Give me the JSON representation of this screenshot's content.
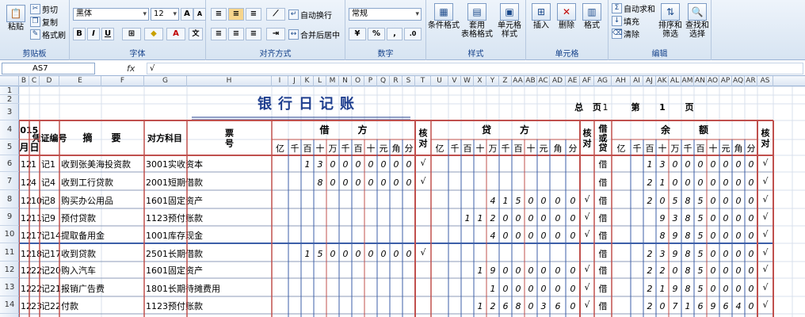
{
  "ribbon": {
    "clipboard": {
      "paste": "粘贴",
      "cut": "剪切",
      "copy": "复制",
      "format_painter": "格式刷",
      "label": "剪贴板"
    },
    "font": {
      "name": "黑体",
      "size": "12",
      "bold": "B",
      "italic": "I",
      "underline": "U",
      "label": "字体",
      "grow": "A",
      "shrink": "A"
    },
    "alignment": {
      "wrap": "自动换行",
      "merge": "合并后居中",
      "label": "对齐方式"
    },
    "number": {
      "format": "常规",
      "percent": "%",
      "comma": ",",
      "label": "数字"
    },
    "styles": {
      "conditional": "条件格式",
      "table": "套用\n表格格式",
      "cell": "单元格\n样式",
      "label": "样式"
    },
    "cells": {
      "insert": "插入",
      "delete": "删除",
      "format": "格式",
      "label": "单元格"
    },
    "editing": {
      "autosum": "自动求和",
      "fill": "填充",
      "clear": "清除",
      "sort": "排序和\n筛选",
      "find": "查找和\n选择",
      "label": "编辑"
    }
  },
  "formula_bar": {
    "name_box": "AS7",
    "fx": "fx",
    "content": "√"
  },
  "columns": [
    "B",
    "C",
    "D",
    "E",
    "F",
    "G",
    "H",
    "I",
    "J",
    "K",
    "L",
    "M",
    "N",
    "O",
    "P",
    "Q",
    "R",
    "S",
    "T",
    "U",
    "V",
    "W",
    "X",
    "Y",
    "Z",
    "AA",
    "AB",
    "AC",
    "AD",
    "AE",
    "AF",
    "AG",
    "AH",
    "AI",
    "AJ",
    "AK",
    "AL",
    "AM",
    "AN",
    "AO",
    "AP",
    "AQ",
    "AR",
    "AS"
  ],
  "rows": [
    "1",
    "2",
    "3",
    "4",
    "5",
    "6",
    "7",
    "8",
    "9",
    "10",
    "11",
    "12",
    "13",
    "14"
  ],
  "ledger": {
    "title": "银行日记账",
    "total_pages_label": "总 页",
    "total_pages": "1",
    "page_prefix": "第",
    "page_no": "1",
    "page_suffix": "页",
    "headers": {
      "year": "2015",
      "month": "月",
      "day": "日",
      "voucher": "凭证编号",
      "summary": "摘　　要",
      "account": "对方科目",
      "ticket": "票\n号",
      "debit": "借　　　方",
      "check": "核\n对",
      "credit": "贷　　　方",
      "direction": "借\n或\n贷",
      "balance": "余　　　额"
    },
    "digits": [
      "亿",
      "千",
      "百",
      "十",
      "万",
      "千",
      "百",
      "十",
      "元",
      "角",
      "分"
    ],
    "entries": [
      {
        "month": "12",
        "day": "1",
        "voucher": "记1",
        "summary": "收到张美海投资款",
        "account": "3001实收资本",
        "debit": "130000000",
        "dcheck": "√",
        "credit": "",
        "ccheck": "",
        "dir": "借",
        "balance": "130000000",
        "bcheck": "√"
      },
      {
        "month": "12",
        "day": "4",
        "voucher": "记4",
        "summary": "收到工行贷款",
        "account": "2001短期借款",
        "debit": "80000000",
        "dcheck": "√",
        "credit": "",
        "ccheck": "",
        "dir": "借",
        "balance": "210000000",
        "bcheck": "√"
      },
      {
        "month": "12",
        "day": "10",
        "voucher": "记8",
        "summary": "购买办公用品",
        "account": "1601固定资产",
        "debit": "",
        "dcheck": "",
        "credit": "4150000",
        "ccheck": "√",
        "dir": "借",
        "balance": "205850000",
        "bcheck": "√"
      },
      {
        "month": "12",
        "day": "11",
        "voucher": "记9",
        "summary": "预付贷款",
        "account": "1123预付账款",
        "debit": "",
        "dcheck": "",
        "credit": "112000000",
        "ccheck": "√",
        "dir": "借",
        "balance": "93850000",
        "bcheck": "√"
      },
      {
        "month": "12",
        "day": "17",
        "voucher": "记14",
        "summary": "提取备用金",
        "account": "1001库存现金",
        "debit": "",
        "dcheck": "",
        "credit": "4000000",
        "ccheck": "√",
        "dir": "借",
        "balance": "89850000",
        "bcheck": "√"
      },
      {
        "month": "12",
        "day": "18",
        "voucher": "记17",
        "summary": "收到贷款",
        "account": "2501长期借款",
        "debit": "150000000",
        "dcheck": "√",
        "credit": "",
        "ccheck": "",
        "dir": "借",
        "balance": "239850000",
        "bcheck": "√"
      },
      {
        "month": "12",
        "day": "22",
        "voucher": "记20",
        "summary": "购入汽车",
        "account": "1601固定资产",
        "debit": "",
        "dcheck": "",
        "credit": "19000000",
        "ccheck": "√",
        "dir": "借",
        "balance": "220850000",
        "bcheck": "√"
      },
      {
        "month": "12",
        "day": "22",
        "voucher": "记21",
        "summary": "报销广告费",
        "account": "1801长期待摊费用",
        "debit": "",
        "dcheck": "",
        "credit": "1000000",
        "ccheck": "√",
        "dir": "借",
        "balance": "219850000",
        "bcheck": "√"
      },
      {
        "month": "12",
        "day": "23",
        "voucher": "记22",
        "summary": "付款",
        "account": "1123预付账款",
        "debit": "",
        "dcheck": "",
        "credit": "12680360",
        "ccheck": "√",
        "dir": "借",
        "balance": "207169640",
        "bcheck": "√"
      }
    ]
  },
  "colors": {
    "title": "#1f3f8f",
    "grid_red": "#c0504d",
    "grid_blue": "#3c5fa8",
    "text": "#000000"
  }
}
